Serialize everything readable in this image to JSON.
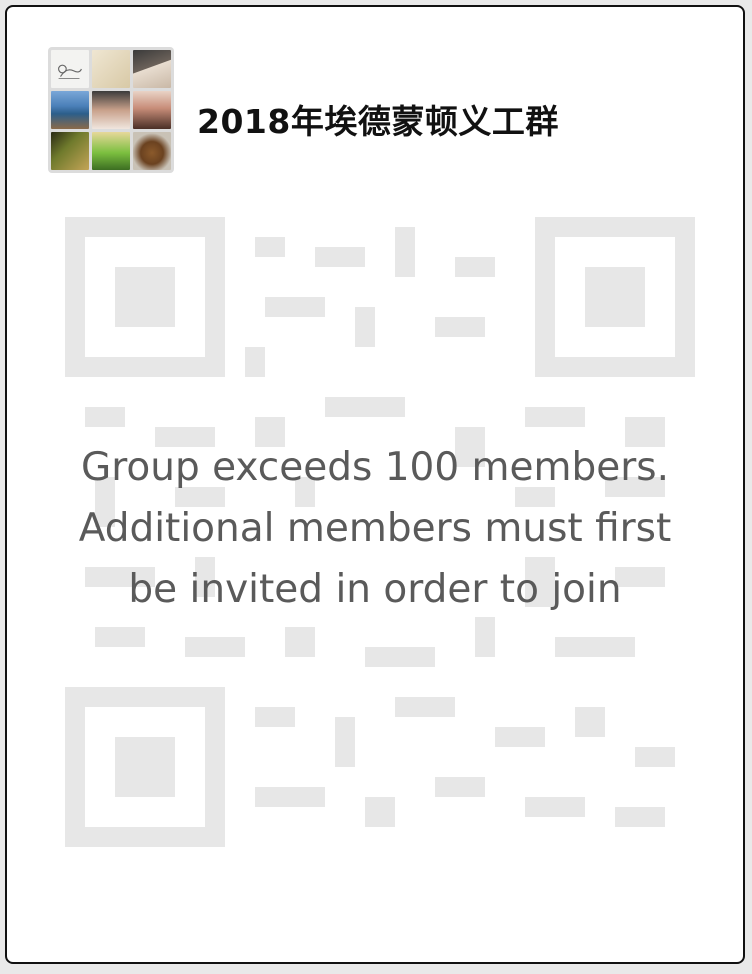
{
  "group": {
    "name": "2018年埃德蒙顿义工群",
    "avatar_tiles": [
      "photo-1",
      "photo-2",
      "photo-3",
      "photo-4",
      "photo-5",
      "photo-6",
      "photo-7",
      "photo-8",
      "photo-9"
    ]
  },
  "notice": {
    "line1": "Group exceeds 100 members.",
    "line2": "Additional members must first",
    "line3": "be invited in order to join"
  },
  "qr": {
    "icon": "qr-code-icon",
    "state": "disabled"
  }
}
